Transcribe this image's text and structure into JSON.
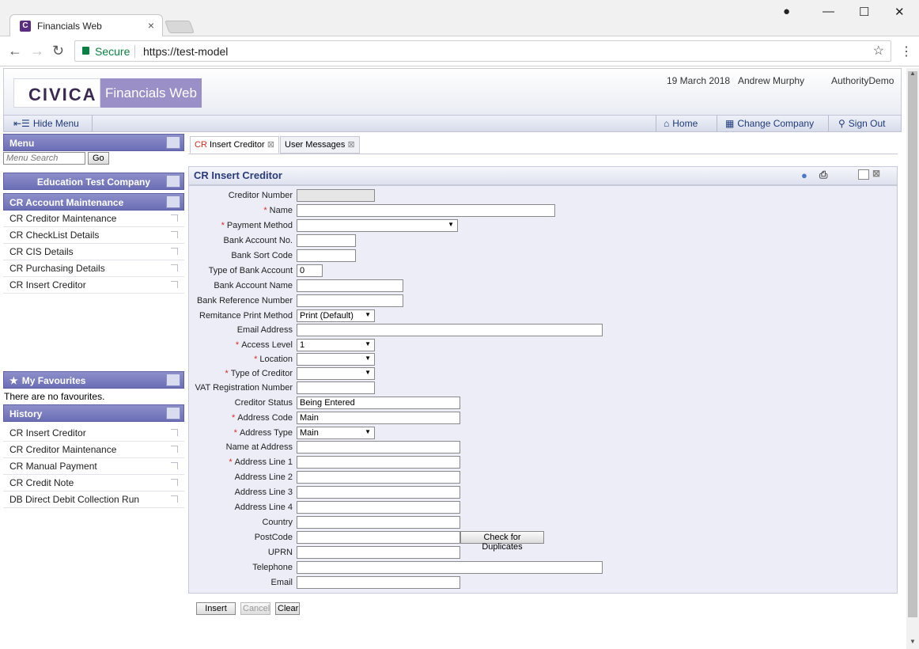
{
  "browser": {
    "tab_title": "Financials Web",
    "secure_label": "Secure",
    "url": "https://test-model"
  },
  "header": {
    "logo": "CIVICA",
    "brand": "Financials Web",
    "date": "19 March 2018",
    "user": "Andrew Murphy",
    "authority": "AuthorityDemo"
  },
  "toolbar": {
    "hide_menu": "Hide Menu",
    "home": "Home",
    "change_company": "Change Company",
    "sign_out": "Sign Out"
  },
  "sidebar": {
    "menu_title": "Menu",
    "search_placeholder": "Menu Search",
    "go_label": "Go",
    "company": "Education Test Company",
    "section": "CR Account Maintenance",
    "items": [
      {
        "label": "CR Creditor Maintenance"
      },
      {
        "label": "CR CheckList Details"
      },
      {
        "label": "CR CIS Details"
      },
      {
        "label": "CR Purchasing Details"
      },
      {
        "label": "CR Insert Creditor"
      }
    ],
    "favourites_title": "My Favourites",
    "favourites_empty": "There are no favourites.",
    "history_title": "History",
    "history": [
      {
        "label": "CR Insert Creditor"
      },
      {
        "label": "CR Creditor Maintenance"
      },
      {
        "label": "CR Manual Payment"
      },
      {
        "label": "CR Credit Note"
      },
      {
        "label": "DB Direct Debit Collection Run"
      }
    ]
  },
  "tabs": {
    "active_prefix": "CR",
    "active_rest": "Insert Creditor",
    "second": "User Messages"
  },
  "panel": {
    "title": "CR Insert Creditor"
  },
  "form": {
    "fields": [
      {
        "label": "Creditor Number",
        "value": ""
      },
      {
        "label": "Name",
        "value": ""
      },
      {
        "label": "Payment Method",
        "value": ""
      },
      {
        "label": "Bank Account No.",
        "value": ""
      },
      {
        "label": "Bank Sort Code",
        "value": ""
      },
      {
        "label": "Type of Bank Account",
        "value": "0"
      },
      {
        "label": "Bank Account Name",
        "value": ""
      },
      {
        "label": "Bank Reference Number",
        "value": ""
      },
      {
        "label": "Remitance Print Method",
        "value": "Print (Default)"
      },
      {
        "label": "Email Address",
        "value": ""
      },
      {
        "label": "Access Level",
        "value": "1"
      },
      {
        "label": "Location",
        "value": ""
      },
      {
        "label": "Type of Creditor",
        "value": ""
      },
      {
        "label": "VAT Registration Number",
        "value": ""
      },
      {
        "label": "Creditor Status",
        "value": "Being Entered"
      },
      {
        "label": "Address Code",
        "value": "Main"
      },
      {
        "label": "Address Type",
        "value": "Main"
      },
      {
        "label": "Name at Address",
        "value": ""
      },
      {
        "label": "Address Line 1",
        "value": ""
      },
      {
        "label": "Address Line 2",
        "value": ""
      },
      {
        "label": "Address Line 3",
        "value": ""
      },
      {
        "label": "Address Line 4",
        "value": ""
      },
      {
        "label": "Country",
        "value": ""
      },
      {
        "label": "PostCode",
        "value": ""
      },
      {
        "label": "UPRN",
        "value": ""
      },
      {
        "label": "Telephone",
        "value": ""
      },
      {
        "label": "Email",
        "value": ""
      }
    ],
    "check_duplicates": "Check for Duplicates"
  },
  "actions": {
    "insert": "Insert",
    "cancel": "Cancel",
    "clear": "Clear"
  }
}
